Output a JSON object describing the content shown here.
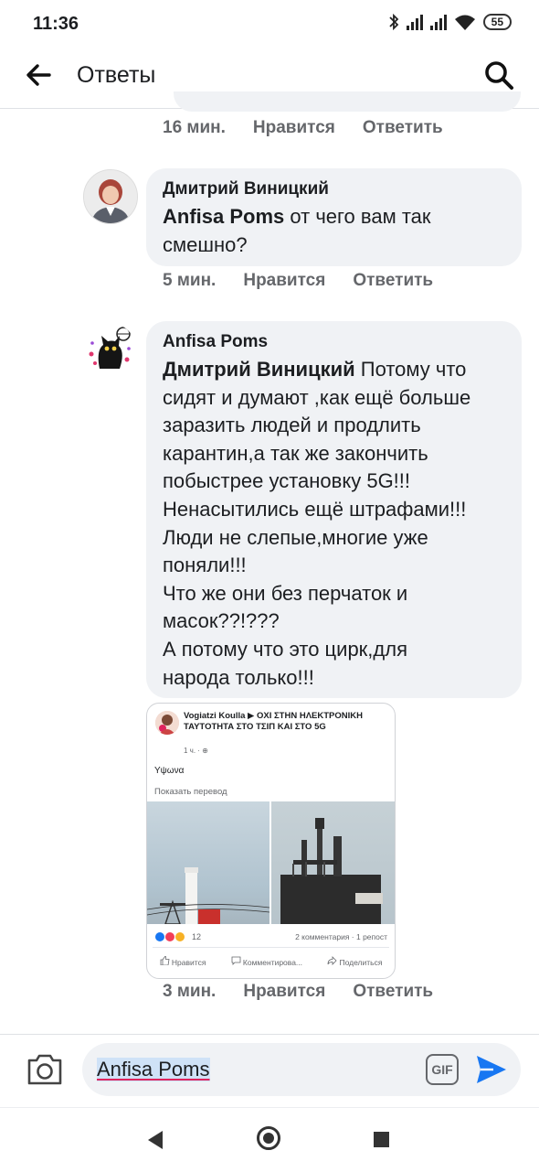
{
  "status_bar": {
    "time": "11:36",
    "battery": "55"
  },
  "header": {
    "title": "Ответы"
  },
  "prev_comment": {
    "time": "16 мин.",
    "like": "Нравится",
    "reply": "Ответить"
  },
  "comments": [
    {
      "author": "Дмитрий Виницкий",
      "mention": "Anfisa Poms",
      "text": " от чего вам так\nсмешно?",
      "time": "5 мин.",
      "like": "Нравится",
      "reply": "Ответить"
    },
    {
      "author": "Anfisa Poms",
      "mention": "Дмитрий Виницкий",
      "text": " Потому что\nсидят и думают ,как ещё больше\nзаразить людей и продлить\nкарантин,а так же закончить\nпобыстрее установку 5G!!!\nНенасытились ещё штрафами!!!\nЛюди не слепые,многие уже\nпоняли!!!\nЧто же они без перчаток и\nмасок??!???\nА потому что это цирк,для\nнарода только!!!",
      "time": "3 мин.",
      "like": "Нравится",
      "reply": "Ответить",
      "attachment": {
        "header": "Vogiatzi Koulla ▶ ΟΧΙ ΣΤΗΝ ΗΛΕΚΤΡΟΝΙΚΗ ΤΑΥΤΟΤΗΤΑ ΣΤΟ ΤΣΙΠ ΚΑΙ ΣΤΟ 5G",
        "time": "1 ч. · ⊕",
        "body": "Υψωνα",
        "translate": "Показать перевод",
        "reactions_count": "12",
        "stats": "2 комментария · 1 репост",
        "like": "Нравится",
        "comment": "Комментирова...",
        "share": "Поделиться"
      }
    }
  ],
  "composer": {
    "value": "Anfisa Poms",
    "gif": "GIF"
  },
  "colors": {
    "bubble": "#f0f2f5",
    "accent": "#1877f2",
    "meta": "#65676b"
  }
}
